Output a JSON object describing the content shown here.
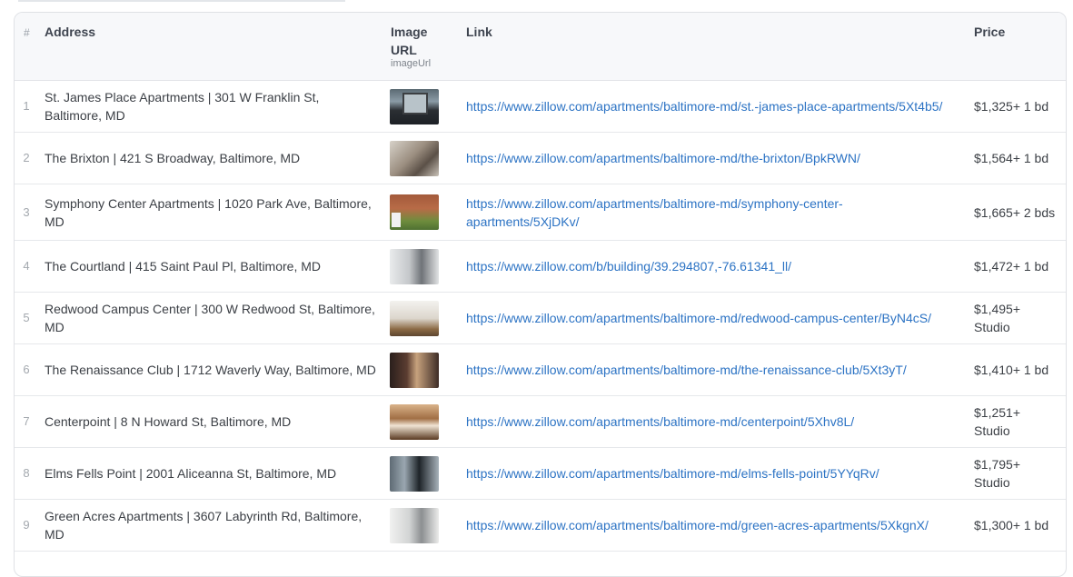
{
  "table": {
    "headers": {
      "num": "#",
      "address": "Address",
      "image_line1": "Image",
      "image_line2": "URL",
      "image_sub": "imageUrl",
      "link": "Link",
      "price": "Price"
    },
    "rows": [
      {
        "num": "1",
        "address": "St. James Place Apartments | 301 W Franklin St, Baltimore, MD",
        "link": "https://www.zillow.com/apartments/baltimore-md/st.-james-place-apartments/5Xt4b5/",
        "price": "$1,325+ 1 bd"
      },
      {
        "num": "2",
        "address": "The Brixton | 421 S Broadway, Baltimore, MD",
        "link": "https://www.zillow.com/apartments/baltimore-md/the-brixton/BpkRWN/",
        "price": "$1,564+ 1 bd"
      },
      {
        "num": "3",
        "address": "Symphony Center Apartments | 1020 Park Ave, Baltimore, MD",
        "link": "https://www.zillow.com/apartments/baltimore-md/symphony-center-apartments/5XjDKv/",
        "price": "$1,665+ 2 bds"
      },
      {
        "num": "4",
        "address": "The Courtland | 415 Saint Paul Pl, Baltimore, MD",
        "link": "https://www.zillow.com/b/building/39.294807,-76.61341_ll/",
        "price": "$1,472+ 1 bd"
      },
      {
        "num": "5",
        "address": "Redwood Campus Center | 300 W Redwood St, Baltimore, MD",
        "link": "https://www.zillow.com/apartments/baltimore-md/redwood-campus-center/ByN4cS/",
        "price": "$1,495+ Studio"
      },
      {
        "num": "6",
        "address": "The Renaissance Club | 1712 Waverly Way, Baltimore, MD",
        "link": "https://www.zillow.com/apartments/baltimore-md/the-renaissance-club/5Xt3yT/",
        "price": "$1,410+ 1 bd"
      },
      {
        "num": "7",
        "address": "Centerpoint | 8 N Howard St, Baltimore, MD",
        "link": "https://www.zillow.com/apartments/baltimore-md/centerpoint/5Xhv8L/",
        "price": "$1,251+ Studio"
      },
      {
        "num": "8",
        "address": "Elms Fells Point | 2001 Aliceanna St, Baltimore, MD",
        "link": "https://www.zillow.com/apartments/baltimore-md/elms-fells-point/5YYqRv/",
        "price": "$1,795+ Studio"
      },
      {
        "num": "9",
        "address": "Green Acres Apartments | 3607 Labyrinth Rd, Baltimore, MD",
        "link": "https://www.zillow.com/apartments/baltimore-md/green-acres-apartments/5XkgnX/",
        "price": "$1,300+ 1 bd"
      }
    ]
  }
}
